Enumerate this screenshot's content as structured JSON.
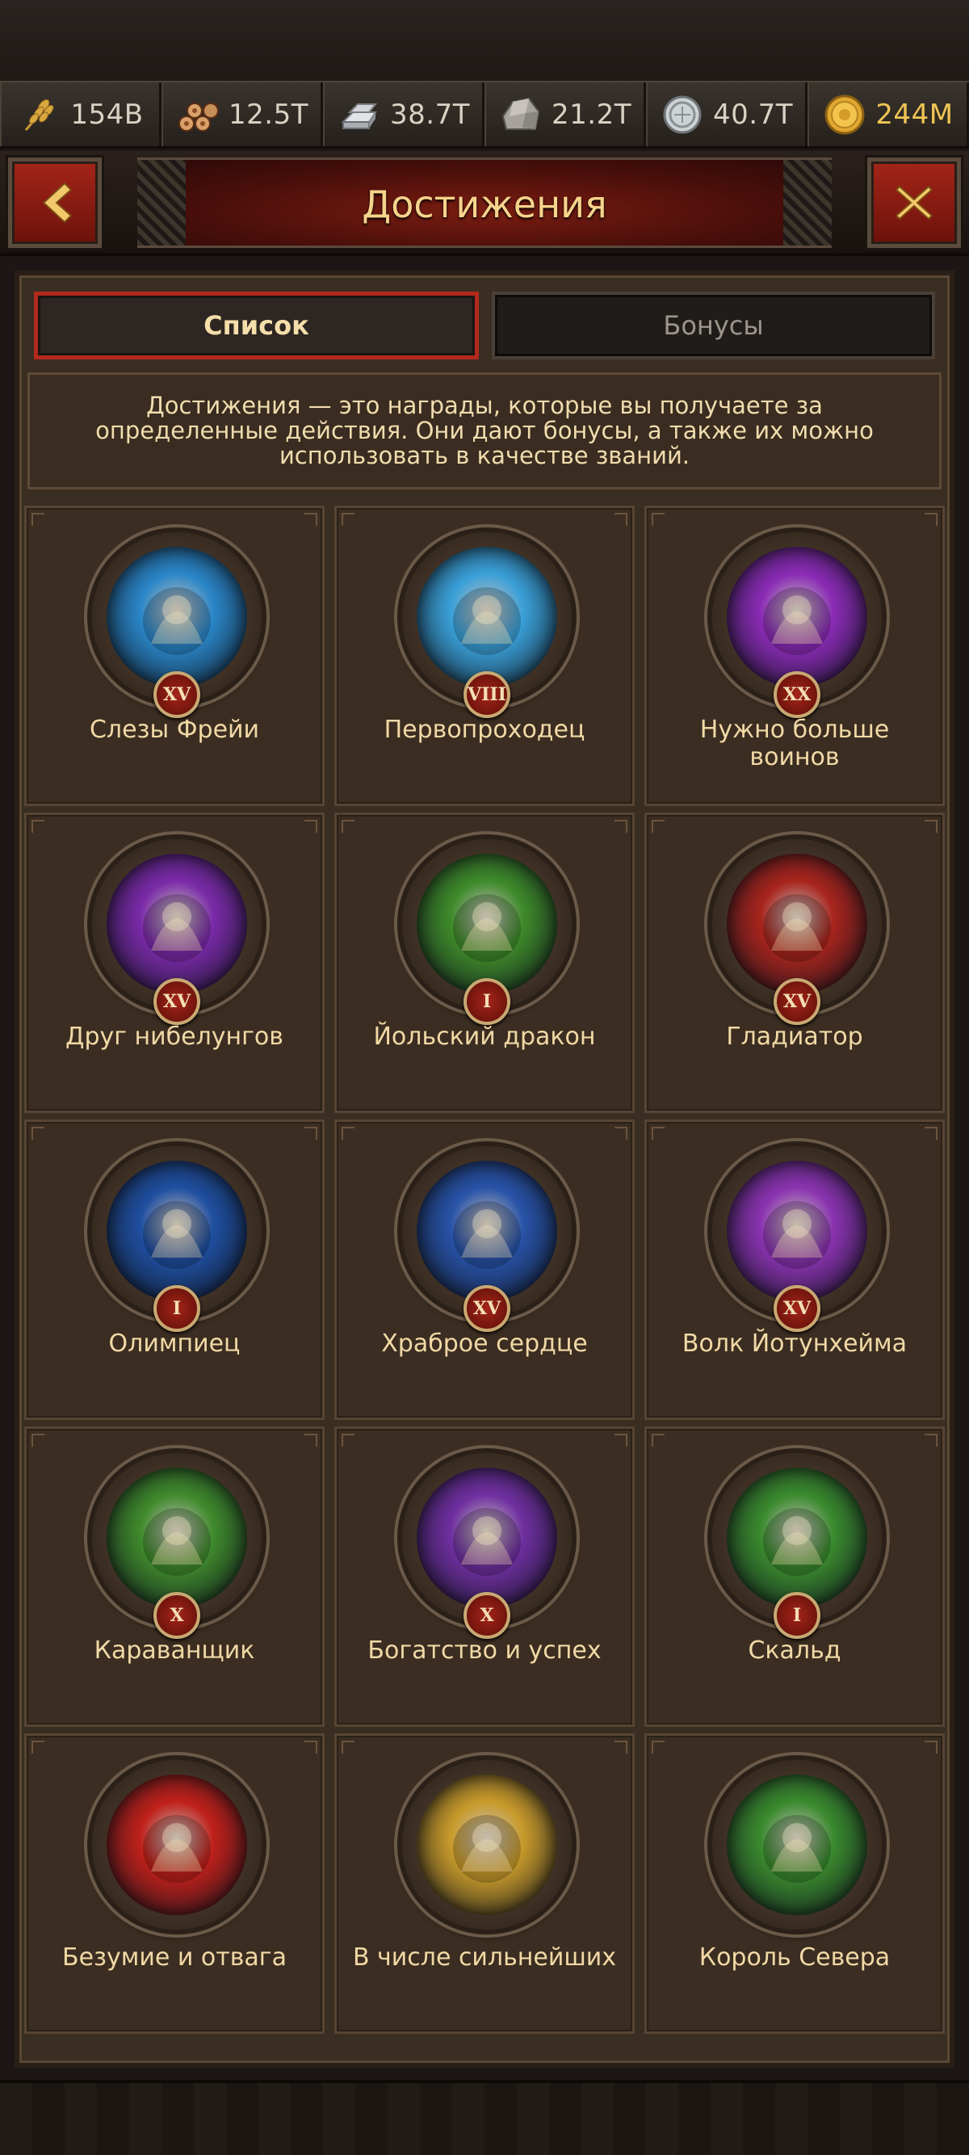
{
  "resources": [
    {
      "icon": "wheat-icon",
      "value": "154B"
    },
    {
      "icon": "wood-logs-icon",
      "value": "12.5T"
    },
    {
      "icon": "iron-ingot-icon",
      "value": "38.7T"
    },
    {
      "icon": "stone-icon",
      "value": "21.2T"
    },
    {
      "icon": "silver-coin-icon",
      "value": "40.7T"
    },
    {
      "icon": "gold-coin-icon",
      "value": "244M"
    }
  ],
  "header": {
    "title": "Достижения",
    "back_icon": "chevron-left-icon",
    "close_icon": "close-icon"
  },
  "tabs": [
    {
      "label": "Список",
      "active": true
    },
    {
      "label": "Бонусы",
      "active": false
    }
  ],
  "description": "Достижения — это награды, которые вы получаете за определенные действия. Они дают бонусы, а также их можно использовать в качестве званий.",
  "achievements": [
    {
      "name": "Слезы Фрейи",
      "rank": "XV",
      "bg": "#2a86c8"
    },
    {
      "name": "Первопроходец",
      "rank": "VIII",
      "bg": "#3aa0d8"
    },
    {
      "name": "Нужно больше воинов",
      "rank": "XX",
      "bg": "#8a2bb5"
    },
    {
      "name": "Друг нибелунгов",
      "rank": "XV",
      "bg": "#7a2aa8"
    },
    {
      "name": "Йольский дракон",
      "rank": "I",
      "bg": "#3e8a2a"
    },
    {
      "name": "Гладиатор",
      "rank": "XV",
      "bg": "#a8241d"
    },
    {
      "name": "Олимпиец",
      "rank": "I",
      "bg": "#1f4fa0"
    },
    {
      "name": "Храброе сердце",
      "rank": "XV",
      "bg": "#2853a8"
    },
    {
      "name": "Волк Йотунхейма",
      "rank": "XV",
      "bg": "#8a33b0"
    },
    {
      "name": "Караванщик",
      "rank": "X",
      "bg": "#3f8a2c"
    },
    {
      "name": "Богатство и успех",
      "rank": "X",
      "bg": "#6f2fa0"
    },
    {
      "name": "Скальд",
      "rank": "I",
      "bg": "#3a8a2e"
    },
    {
      "name": "Безумие и отвага",
      "rank": "",
      "bg": "#c0201a"
    },
    {
      "name": "В числе сильнейших",
      "rank": "",
      "bg": "#c89a2a"
    },
    {
      "name": "Король Севера",
      "rank": "",
      "bg": "#3a8a2e"
    }
  ]
}
